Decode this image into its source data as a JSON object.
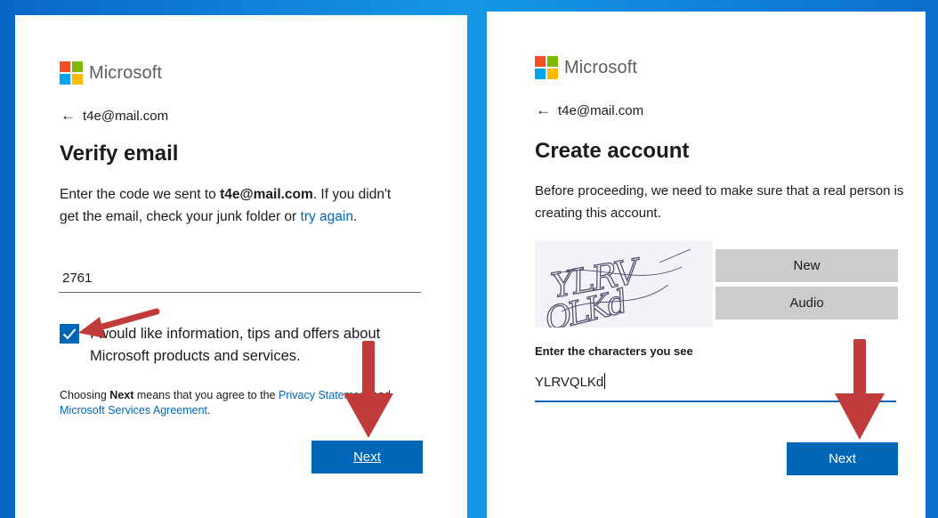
{
  "brand": "Microsoft",
  "left": {
    "back_email": "t4e@mail.com",
    "title": "Verify email",
    "desc": {
      "p1": "Enter the code we sent to ",
      "email": "t4e@mail.com",
      "p2": ". If you didn't get the email, check your junk folder or ",
      "try_again": "try again",
      "p3": "."
    },
    "code_value": "2761",
    "checkbox_label": "I would like information, tips and offers about Microsoft products and services.",
    "checkbox_checked": true,
    "terms": {
      "p1": "Choosing ",
      "bold": "Next",
      "p2": " means that you agree to the ",
      "privacy": "Privacy Statement",
      "p3": " and ",
      "agreement": "Microsoft Services Agreement",
      "p4": "."
    },
    "next_label": "Next"
  },
  "right": {
    "back_email": "t4e@mail.com",
    "title": "Create account",
    "desc": "Before proceeding, we need to make sure that a real person is creating this account.",
    "captcha_text": "YLRVQLKd",
    "new_label": "New",
    "audio_label": "Audio",
    "field_label": "Enter the characters you see",
    "field_value": "YLRVQLKd",
    "next_label": "Next"
  },
  "colors": {
    "accent": "#0067b8",
    "annotation_arrow": "#c23b3b",
    "background": "#0a66c8"
  }
}
